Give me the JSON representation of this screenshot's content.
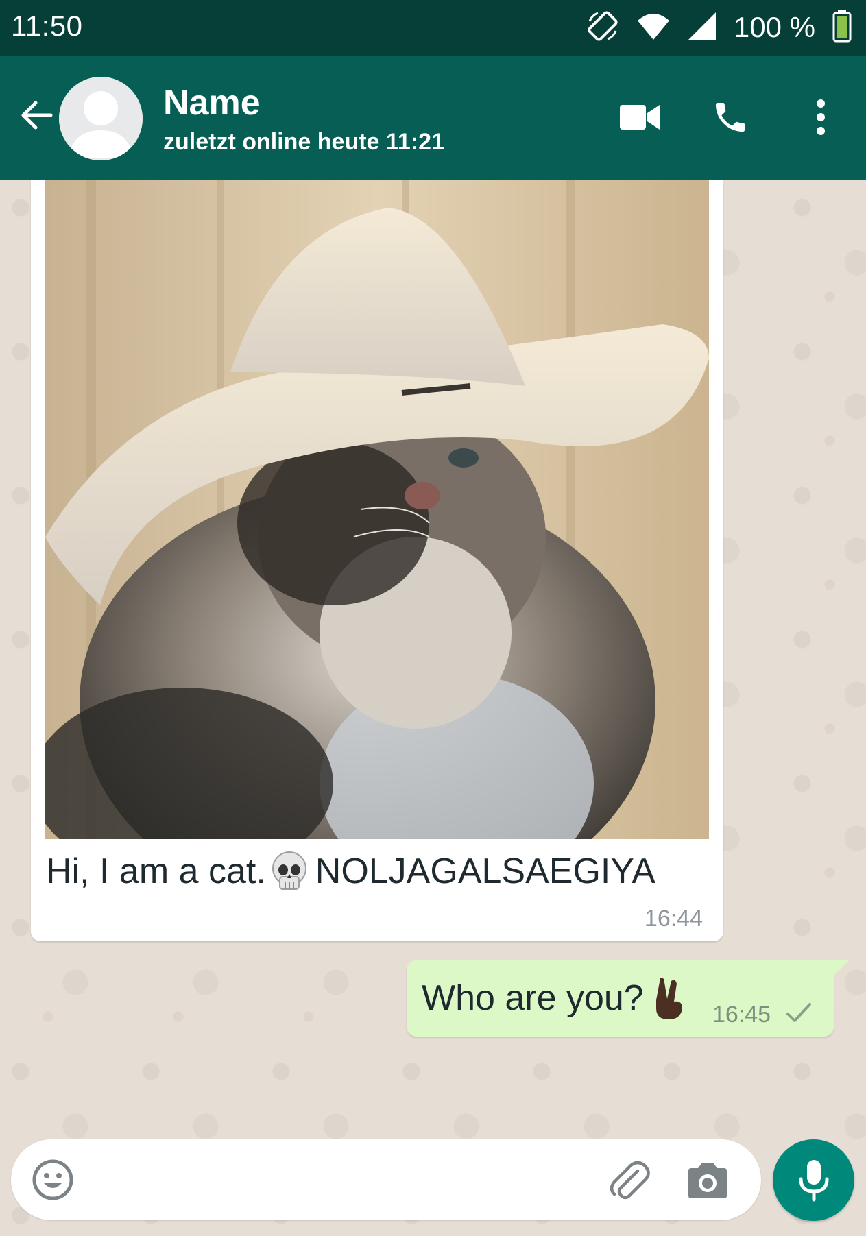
{
  "status_bar": {
    "time": "11:50",
    "battery_percent": "100 %",
    "icons": [
      "rotate-icon",
      "wifi-icon",
      "signal-icon",
      "battery-icon"
    ]
  },
  "header": {
    "contact_name": "Name",
    "last_seen": "zuletzt online heute 11:21",
    "icons": [
      "back-arrow-icon",
      "avatar-placeholder-icon",
      "video-call-icon",
      "phone-call-icon",
      "more-vert-icon"
    ]
  },
  "messages": [
    {
      "direction": "incoming",
      "type": "image",
      "caption_before_emoji": "Hi, I am a cat.",
      "emoji": "skull-emoji",
      "caption_after_emoji": "NOLJAGALSAEGIYA",
      "time": "16:44"
    },
    {
      "direction": "outgoing",
      "type": "text",
      "text": "Who are you?",
      "emoji": "victory-hand-emoji",
      "time": "16:45",
      "status": "sent-single-check-icon"
    }
  ],
  "composer": {
    "placeholder": "",
    "icons": [
      "emoji-icon",
      "paperclip-icon",
      "camera-icon",
      "microphone-icon"
    ]
  },
  "colors": {
    "status_bar": "#063f37",
    "header": "#075e54",
    "chat_background": "#e6ded5",
    "incoming_bubble": "#ffffff",
    "outgoing_bubble": "#dcf8c6",
    "mic_button": "#00897b"
  }
}
